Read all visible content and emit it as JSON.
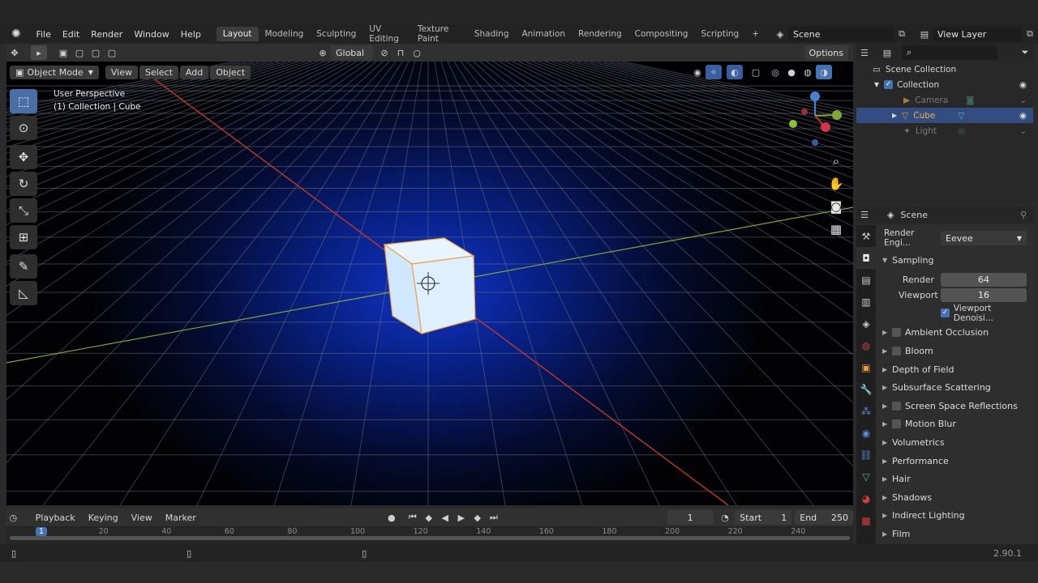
{
  "menubar": {
    "items": [
      "File",
      "Edit",
      "Render",
      "Window",
      "Help"
    ],
    "workspaces": [
      "Layout",
      "Modeling",
      "Sculpting",
      "UV Editing",
      "Texture Paint",
      "Shading",
      "Animation",
      "Rendering",
      "Compositing",
      "Scripting"
    ],
    "active_workspace": "Layout",
    "scene": "Scene",
    "view_layer": "View Layer"
  },
  "toolbar": {
    "orientation": "Global",
    "options": "Options"
  },
  "viewport_header": {
    "mode": "Object Mode",
    "menus": [
      "View",
      "Select",
      "Add",
      "Object"
    ]
  },
  "viewport": {
    "perspective": "User Perspective",
    "context": "(1) Collection | Cube"
  },
  "outliner": {
    "root": "Scene Collection",
    "collection": "Collection",
    "items": [
      "Camera",
      "Cube",
      "Light"
    ],
    "selected": "Cube"
  },
  "properties": {
    "header_title": "Scene",
    "render_engine_label": "Render Engi...",
    "render_engine": "Eevee",
    "sampling_label": "Sampling",
    "render_label": "Render",
    "render_samples": "64",
    "viewport_label": "Viewport",
    "viewport_samples": "16",
    "denoise_label": "Viewport Denoisi...",
    "panels": [
      {
        "label": "Ambient Occlusion",
        "checkbox": true
      },
      {
        "label": "Bloom",
        "checkbox": true
      },
      {
        "label": "Depth of Field",
        "checkbox": false
      },
      {
        "label": "Subsurface Scattering",
        "checkbox": false
      },
      {
        "label": "Screen Space Reflections",
        "checkbox": true
      },
      {
        "label": "Motion Blur",
        "checkbox": true
      },
      {
        "label": "Volumetrics",
        "checkbox": false
      },
      {
        "label": "Performance",
        "checkbox": false
      },
      {
        "label": "Hair",
        "checkbox": false
      },
      {
        "label": "Shadows",
        "checkbox": false
      },
      {
        "label": "Indirect Lighting",
        "checkbox": false
      },
      {
        "label": "Film",
        "checkbox": false
      }
    ]
  },
  "timeline": {
    "menus": [
      "Playback",
      "Keying",
      "View",
      "Marker"
    ],
    "current_frame": "1",
    "start_label": "Start",
    "start": "1",
    "end_label": "End",
    "end": "250",
    "ruler": [
      "1",
      "20",
      "40",
      "60",
      "80",
      "100",
      "120",
      "140",
      "160",
      "180",
      "200",
      "220",
      "240"
    ]
  },
  "status": {
    "version": "2.90.1"
  },
  "colors": {
    "accent": "#4772b3",
    "selection": "#334d80",
    "x_axis": "#c0392b",
    "y_axis": "#7fa83a",
    "cube_outline": "#f0a040"
  }
}
